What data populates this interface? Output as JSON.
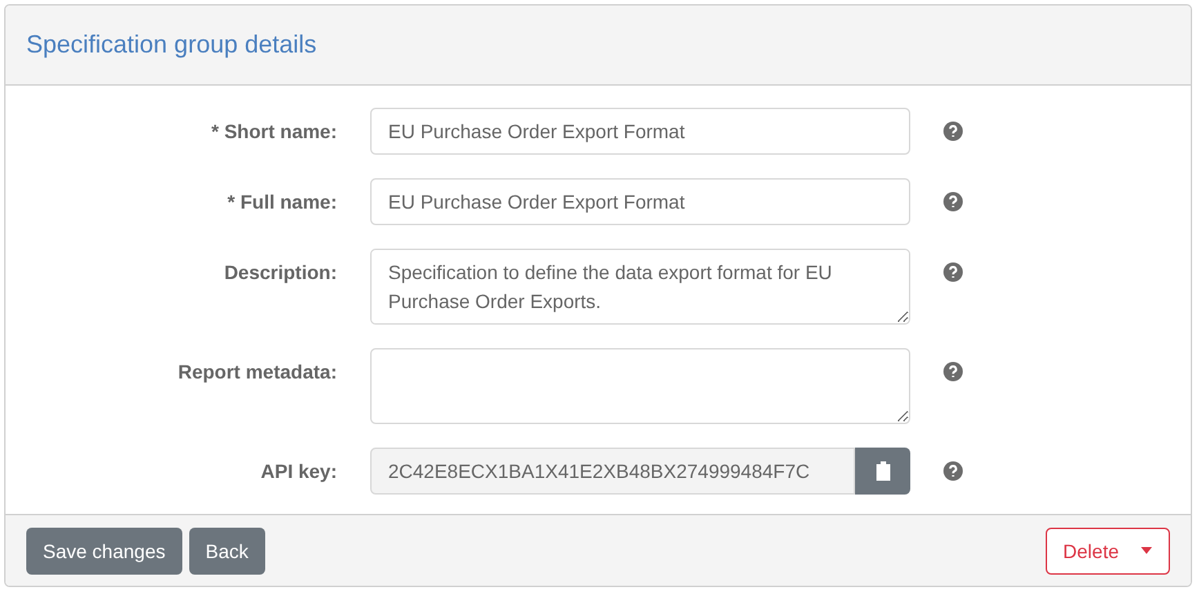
{
  "panel": {
    "title": "Specification group details"
  },
  "fields": [
    {
      "kind": "input",
      "label": "* Short name:",
      "value": "EU Purchase Order Export Format"
    },
    {
      "kind": "input",
      "label": "* Full name:",
      "value": "EU Purchase Order Export Format"
    },
    {
      "kind": "textarea",
      "label": "Description:",
      "value": "Specification to define the data export format for EU Purchase Order Exports."
    },
    {
      "kind": "textarea",
      "label": "Report metadata:"
    },
    {
      "kind": "copy",
      "label": "API key:",
      "value": "2C42E8ECX1BA1X41E2XB48BX274999484F7C",
      "disabled": true
    }
  ],
  "buttons": [
    {
      "label": "Save changes"
    },
    {
      "label": "Back"
    }
  ],
  "delete_button": {
    "label": "Delete"
  }
}
